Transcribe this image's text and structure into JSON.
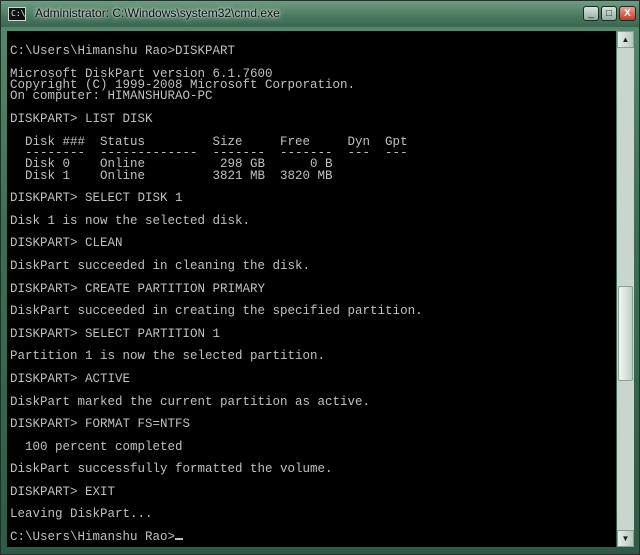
{
  "window": {
    "title": "Administrator: C:\\Windows\\system32\\cmd.exe",
    "icon": "cmd-icon",
    "icon_glyph": "C:\\",
    "controls": {
      "minimize": "_",
      "maximize": "□",
      "close": "X"
    }
  },
  "console": {
    "lines": [
      "",
      "C:\\Users\\Himanshu Rao>DISKPART",
      "",
      "Microsoft DiskPart version 6.1.7600",
      "Copyright (C) 1999-2008 Microsoft Corporation.",
      "On computer: HIMANSHURAO-PC",
      "",
      "DISKPART> LIST DISK",
      "",
      "  Disk ###  Status         Size     Free     Dyn  Gpt",
      "  --------  -------------  -------  -------  ---  ---",
      "  Disk 0    Online          298 GB      0 B",
      "  Disk 1    Online         3821 MB  3820 MB",
      "",
      "DISKPART> SELECT DISK 1",
      "",
      "Disk 1 is now the selected disk.",
      "",
      "DISKPART> CLEAN",
      "",
      "DiskPart succeeded in cleaning the disk.",
      "",
      "DISKPART> CREATE PARTITION PRIMARY",
      "",
      "DiskPart succeeded in creating the specified partition.",
      "",
      "DISKPART> SELECT PARTITION 1",
      "",
      "Partition 1 is now the selected partition.",
      "",
      "DISKPART> ACTIVE",
      "",
      "DiskPart marked the current partition as active.",
      "",
      "DISKPART> FORMAT FS=NTFS",
      "",
      "  100 percent completed",
      "",
      "DiskPart successfully formatted the volume.",
      "",
      "DISKPART> EXIT",
      "",
      "Leaving DiskPart...",
      "",
      "C:\\Users\\Himanshu Rao>"
    ]
  },
  "scrollbar": {
    "up_arrow": "▲",
    "down_arrow": "▼"
  },
  "colors": {
    "console_bg": "#000000",
    "console_fg": "#c0c0c0",
    "title_fg": "#0b0b0b"
  }
}
